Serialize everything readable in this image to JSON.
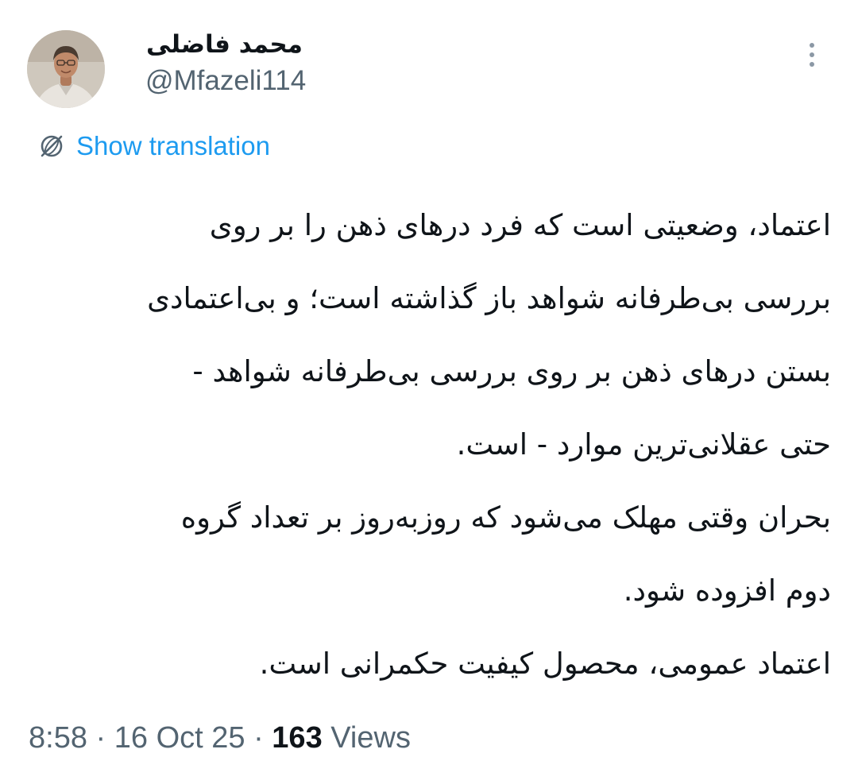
{
  "author": {
    "display_name": "محمد فاضلی",
    "handle": "@Mfazeli114",
    "avatar_icon": "profile-photo"
  },
  "more_icon": "more-vertical-icon",
  "translation": {
    "icon": "translate-globe-icon",
    "label": "Show translation",
    "color": "#1d9bf0"
  },
  "tweet": {
    "lines": [
      "اعتماد، وضعیتی است که فرد درهای ذهن را بر روی",
      "بررسی بی‌طرفانه شواهد باز گذاشته است؛ و بی‌اعتمادی",
      "بستن درهای ذهن بر روی بررسی بی‌طرفانه شواهد -",
      "حتی عقلانی‌ترین موارد - است.",
      "بحران وقتی مهلک می‌شود که روزبه‌روز بر تعداد گروه",
      "دوم افزوده شود.",
      "اعتماد عمومی، محصول کیفیت حکمرانی است."
    ]
  },
  "meta": {
    "time": "8:58",
    "separator": "·",
    "date": "16 Oct 25",
    "views_count": "163",
    "views_label": "Views"
  },
  "colors": {
    "text": "#0f1419",
    "secondary": "#536471",
    "accent": "#1d9bf0"
  }
}
